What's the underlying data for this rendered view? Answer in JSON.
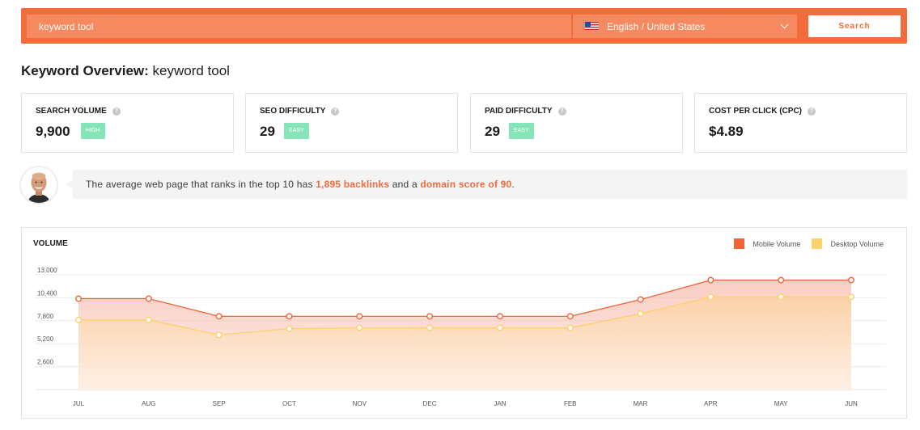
{
  "search": {
    "query": "keyword tool",
    "language": "English / United States",
    "button_label": "Search"
  },
  "page_title": {
    "prefix": "Keyword Overview:",
    "keyword": "keyword tool"
  },
  "metrics": [
    {
      "label": "SEARCH VOLUME",
      "value": "9,900",
      "badge": "HIGH"
    },
    {
      "label": "SEO DIFFICULTY",
      "value": "29",
      "badge": "EASY"
    },
    {
      "label": "PAID DIFFICULTY",
      "value": "29",
      "badge": "EASY"
    },
    {
      "label": "COST PER CLICK (CPC)",
      "value": "$4.89",
      "badge": ""
    }
  ],
  "insight": {
    "text_before": "The average web page that ranks in the top 10 has ",
    "backlinks": "1,895 backlinks",
    "text_middle": " and a ",
    "domain_score": "domain score of 90",
    "text_after": "."
  },
  "colors": {
    "accent": "#f26b3a",
    "badge": "#86e5b8",
    "mobile": "#f0643a",
    "desktop": "#fdd16b"
  },
  "chart_data": {
    "type": "area",
    "title": "VOLUME",
    "categories": [
      "JUL",
      "AUG",
      "SEP",
      "OCT",
      "NOV",
      "DEC",
      "JAN",
      "FEB",
      "MAR",
      "APR",
      "MAY",
      "JUN"
    ],
    "series": [
      {
        "name": "Mobile Volume",
        "values": [
          10300,
          10300,
          8300,
          8300,
          8300,
          8300,
          8300,
          8300,
          10200,
          12400,
          12400,
          12400
        ]
      },
      {
        "name": "Desktop Volume",
        "values": [
          7900,
          7900,
          6200,
          6900,
          7000,
          7000,
          7000,
          7000,
          8600,
          10500,
          10500,
          10500
        ]
      }
    ],
    "yticks": [
      "13,000",
      "10,400",
      "7,800",
      "5,200",
      "2,600"
    ],
    "ytick_values": [
      13000,
      10400,
      7800,
      5200,
      2600
    ],
    "ylim": [
      0,
      13000
    ],
    "grid": true,
    "legend_position": "top-right"
  }
}
